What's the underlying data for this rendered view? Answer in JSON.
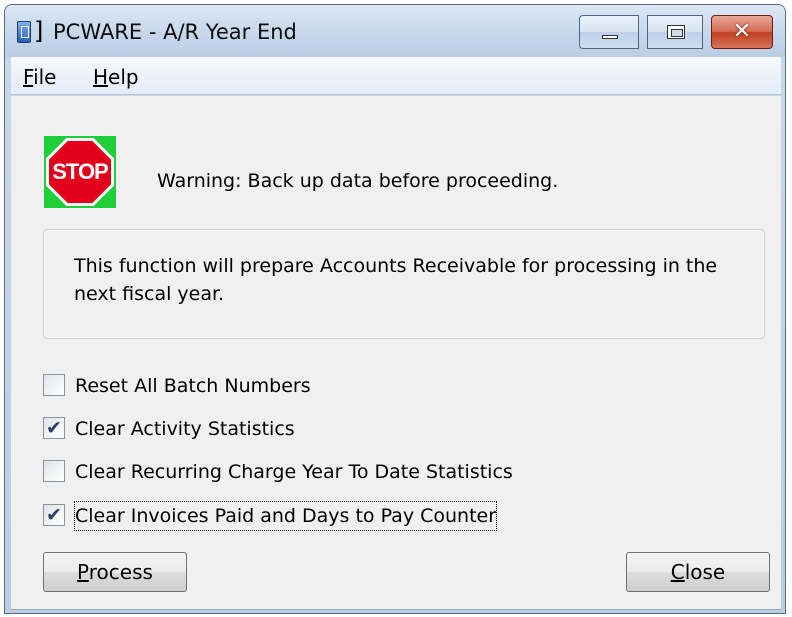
{
  "window": {
    "title": "PCWARE - A/R Year End",
    "close_glyph": "✕"
  },
  "menu": {
    "file": {
      "accel": "F",
      "rest": "ile"
    },
    "help": {
      "accel": "H",
      "rest": "elp"
    }
  },
  "warning": {
    "icon": "stop-sign-icon",
    "icon_text": "STOP",
    "text": "Warning: Back up data before proceeding."
  },
  "info": {
    "text": "This function will prepare Accounts Receivable for processing in the next fiscal year."
  },
  "options": [
    {
      "label": "Reset All Batch Numbers",
      "checked": false
    },
    {
      "label": "Clear Activity Statistics",
      "checked": true
    },
    {
      "label": "Clear Recurring Charge Year To Date Statistics",
      "checked": false
    },
    {
      "label": "Clear Invoices Paid and Days to Pay Counter",
      "checked": true,
      "focused": true
    }
  ],
  "buttons": {
    "process": {
      "accel": "P",
      "rest": "rocess"
    },
    "close": {
      "accel": "C",
      "rest": "lose"
    }
  },
  "colors": {
    "stop_red": "#e3001b",
    "stop_background": "#1fcf3a",
    "close_button": "#c0401f"
  }
}
